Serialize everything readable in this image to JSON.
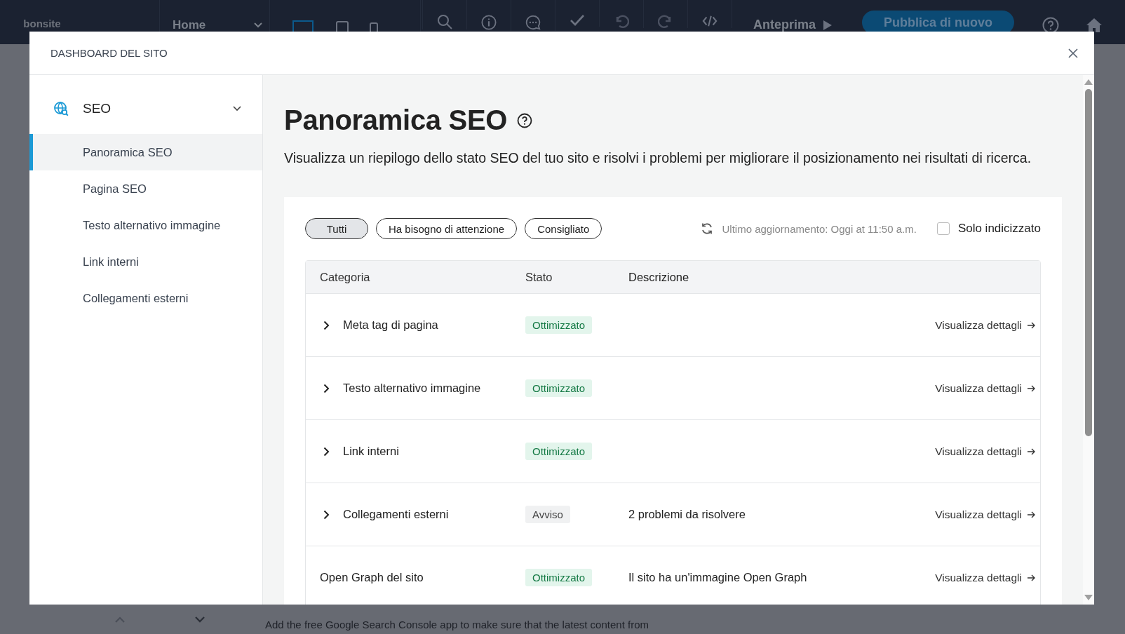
{
  "topbar": {
    "logo": "bonsite",
    "page_select": "Home",
    "devices": [
      {
        "kind": "desktop",
        "selected": true
      },
      {
        "kind": "tablet",
        "selected": false
      },
      {
        "kind": "mobile",
        "selected": false
      }
    ],
    "preview": "Anteprima",
    "publish": "Pubblica di nuovo"
  },
  "background": {
    "text": "Add the free Google Search Console app to make sure that the latest content from"
  },
  "modal": {
    "title": "DASHBOARD DEL SITO",
    "sidebar": {
      "section": "SEO",
      "expanded": true,
      "items": [
        {
          "label": "Panoramica SEO",
          "selected": true
        },
        {
          "label": "Pagina SEO",
          "selected": false
        },
        {
          "label": "Testo alternativo immagine",
          "selected": false
        },
        {
          "label": "Link interni",
          "selected": false
        },
        {
          "label": "Collegamenti esterni",
          "selected": false
        }
      ]
    },
    "heading": "Panoramica SEO",
    "description": "Visualizza un riepilogo dello stato SEO del tuo sito e risolvi i problemi per migliorare il posizionamento nei risultati di ricerca.",
    "filters": [
      {
        "label": "Tutti",
        "selected": true
      },
      {
        "label": "Ha bisogno di attenzione",
        "selected": false
      },
      {
        "label": "Consigliato",
        "selected": false
      }
    ],
    "last_update": "Ultimo aggiornamento: Oggi at 11:50 a.m.",
    "only_indexed": {
      "label": "Solo indicizzato",
      "checked": false
    },
    "table": {
      "columns": [
        "Categoria",
        "Stato",
        "Descrizione"
      ],
      "rows": [
        {
          "category": "Meta tag di pagina",
          "expandable": true,
          "status": "Ottimizzato",
          "kind": "ok",
          "link": "Visualizza dettagli"
        },
        {
          "category": "Testo alternativo immagine",
          "expandable": true,
          "status": "Ottimizzato",
          "kind": "ok",
          "link": "Visualizza dettagli"
        },
        {
          "category": "Link interni",
          "expandable": true,
          "status": "Ottimizzato",
          "kind": "ok",
          "link": "Visualizza dettagli"
        },
        {
          "category": "Collegamenti esterni",
          "expandable": true,
          "status": "Avviso",
          "kind": "warning",
          "description": "2 problemi da risolvere",
          "link": "Visualizza dettagli"
        },
        {
          "category": "Open Graph del sito",
          "expandable": false,
          "status": "Ottimizzato",
          "kind": "ok",
          "description": "Il sito ha un'immagine Open Graph",
          "link": "Visualizza dettagli"
        }
      ]
    }
  }
}
